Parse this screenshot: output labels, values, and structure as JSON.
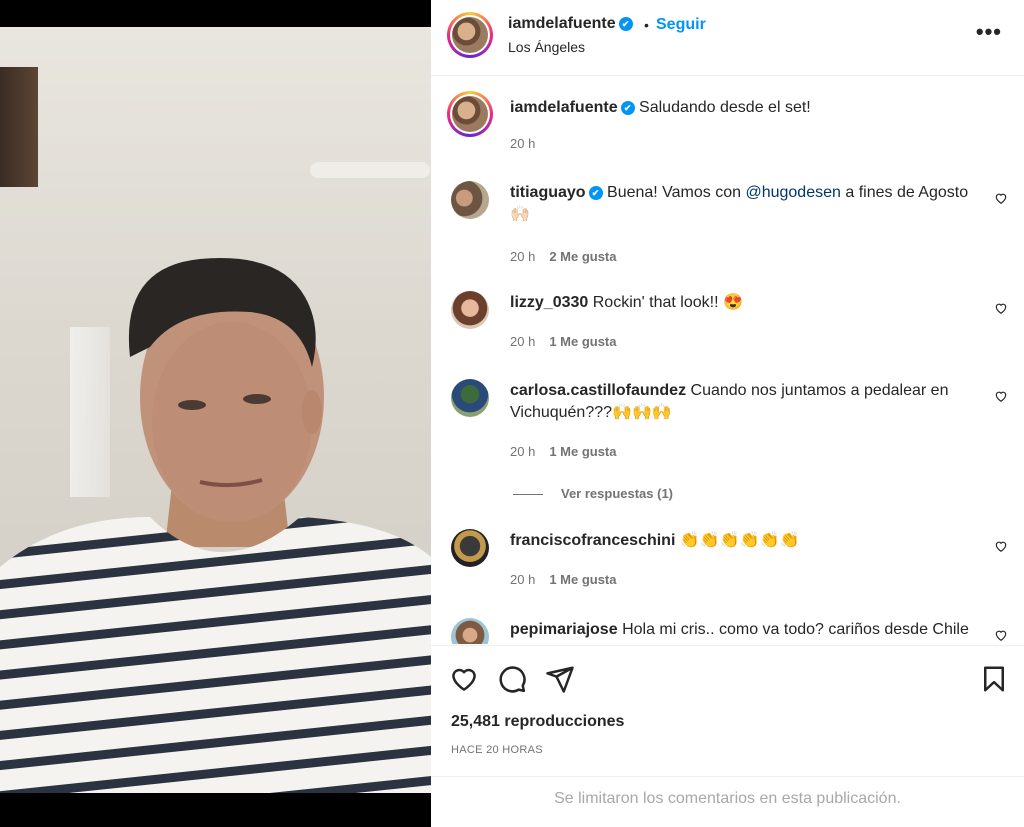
{
  "post": {
    "username": "iamdelafuente",
    "verified_mark": "✔",
    "separator": "•",
    "follow_label": "Seguir",
    "location": "Los Ángeles",
    "more_label": "•••",
    "caption": "Saludando desde el set!",
    "caption_time": "20 h"
  },
  "comments": [
    {
      "username": "titiaguayo",
      "verified": true,
      "text_before": "Buena! Vamos con ",
      "mention": "@hugodesen",
      "text_after": " a fines de Agosto 🙌🏻",
      "time": "20 h",
      "likes": "2 Me gusta"
    },
    {
      "username": "lizzy_0330",
      "text": "Rockin' that look!! 😍",
      "time": "20 h",
      "likes": "1 Me gusta"
    },
    {
      "username": "carlosa.castillofaundez",
      "text": "Cuando nos juntamos a pedalear en Vichuquén???🙌🙌🙌",
      "time": "20 h",
      "likes": "1 Me gusta",
      "replies": "Ver respuestas (1)"
    },
    {
      "username": "franciscofranceschini",
      "text": "👏👏👏👏👏👏",
      "time": "20 h",
      "likes": "1 Me gusta"
    },
    {
      "username": "pepimariajose",
      "text": "Hola mi cris.. como va todo? cariños desde Chile"
    }
  ],
  "actions": {
    "views": "25,481 reproducciones",
    "posted_ago": "HACE 20 HORAS",
    "comments_limited": "Se limitaron los comentarios en esta publicación."
  },
  "colors": {
    "link_blue": "#0095f6",
    "mention_blue": "#00376b",
    "secondary_text": "#737373"
  },
  "icons": [
    "verified-badge-icon",
    "more-options-icon",
    "heart-icon",
    "comment-icon",
    "share-icon",
    "bookmark-icon"
  ]
}
